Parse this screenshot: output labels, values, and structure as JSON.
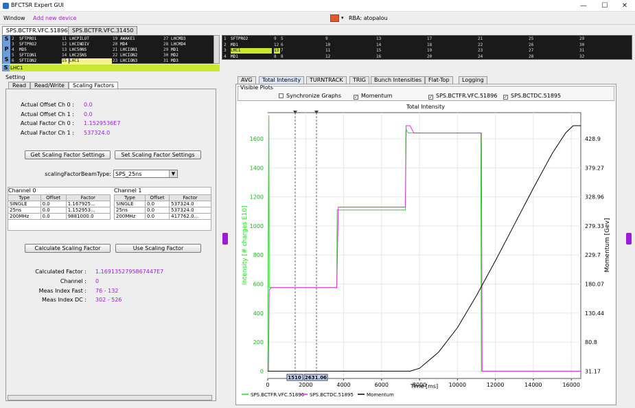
{
  "window": {
    "title": "BFCTSR Expert GUI",
    "minimize": "—",
    "maximize": "☐",
    "close": "✕"
  },
  "menu": {
    "window": "Window",
    "add_device": "Add new device"
  },
  "rba": {
    "label": "RBA: atopalou",
    "arrow": "▾"
  },
  "device_tabs": [
    "SPS.BCTFR.VFC.51896",
    "SPS.BCTFR.VFC.31450"
  ],
  "selector_left": {
    "side_labels": [
      "S",
      "P",
      "S"
    ],
    "rows": [
      [
        "2",
        "SFTPRO1",
        "11",
        "LHCPILOT",
        "19",
        "AWAKE1",
        "27",
        "LHCMD3"
      ],
      [
        "3",
        "SFTPRO2",
        "12",
        "LHCINDIV",
        "20",
        "MD4",
        "28",
        "LHCMD4"
      ],
      [
        "4",
        "MD5",
        "13",
        "LHC50NS",
        "21",
        "LHCION1",
        "29",
        "MD1"
      ],
      [
        "5",
        "SFTION1",
        "14",
        "LHC25NS",
        "22",
        "LHCION2",
        "30",
        "MD2"
      ],
      [
        "6",
        "SFTION2",
        "15",
        "LHC1",
        "23",
        "LHCION3",
        "31",
        "MD3"
      ]
    ],
    "selected": "LHC1"
  },
  "selector_right": {
    "rows": [
      [
        "1",
        "SFTPRO2",
        "9",
        "5",
        "9",
        "13",
        "17",
        "21",
        "25",
        "29"
      ],
      [
        "2",
        "MD1",
        "12",
        "6",
        "10",
        "14",
        "18",
        "22",
        "26",
        "30"
      ],
      [
        "3",
        "LHC1",
        "13",
        "7",
        "11",
        "15",
        "19",
        "23",
        "27",
        "31"
      ],
      [
        "4",
        "MD1",
        "8",
        "8",
        "12",
        "16",
        "20",
        "24",
        "28",
        "32"
      ]
    ]
  },
  "setting": {
    "group_label": "Setting",
    "tabs": [
      "Read",
      "Read/Write",
      "Scaling Factors"
    ],
    "actual": [
      {
        "label": "Actual Offset Ch 0 :",
        "value": "0.0"
      },
      {
        "label": "Actual Offset Ch 1 :",
        "value": "0.0"
      },
      {
        "label": "Actual Factor Ch 0 :",
        "value": "1.1529536E7"
      },
      {
        "label": "Actual Factor Ch 1 :",
        "value": "537324.0"
      }
    ],
    "get_button": "Get Scaling Factor Settings",
    "set_button": "Set Scaling Factor Settings",
    "beam_type_label": "scalingFactorBeamType:",
    "beam_type_value": "SPS_25ns",
    "channel0": {
      "title": "Channel 0",
      "headers": [
        "Type",
        "Offset",
        "Factor"
      ],
      "rows": [
        [
          "SINGLE",
          "0.0",
          "1.167925..."
        ],
        [
          "25ns",
          "0.0",
          "1.152953..."
        ],
        [
          "200MHz",
          "0.0",
          "9881000.0"
        ]
      ]
    },
    "channel1": {
      "title": "Channel 1",
      "headers": [
        "Type",
        "Offset",
        "Factor"
      ],
      "rows": [
        [
          "SINGLE",
          "0.0",
          "537324.0"
        ],
        [
          "25ns",
          "0.0",
          "537324.0"
        ],
        [
          "200MHz",
          "0.0",
          "417762.0..."
        ]
      ]
    },
    "calc_button": "Calculate Scaling Factor",
    "use_button": "Use Scaling Factor",
    "calculated": [
      {
        "label": "Calculated Factor :",
        "value": "1.1691352795867447E7"
      },
      {
        "label": "Channel :",
        "value": "0"
      },
      {
        "label": "Meas Index Fast :",
        "value": "76 - 132"
      },
      {
        "label": "Meas Index DC :",
        "value": "302 - 526"
      }
    ]
  },
  "chart_tabs": [
    "AVG",
    "Total Intensity",
    "TURNTRACK",
    "TRIG",
    "Bunch Intensities",
    "Flat-Top",
    "Logging"
  ],
  "visible_plots": {
    "label": "Visible Plots",
    "items": [
      {
        "label": "Synchronize Graphs",
        "checked": false
      },
      {
        "label": "Momentum",
        "checked": true
      },
      {
        "label": "SPS.BCTFR.VFC.51896",
        "checked": true
      },
      {
        "label": "SPS.BCTDC.51895",
        "checked": true
      }
    ]
  },
  "marker_labels": [
    "1510",
    "2631.06"
  ],
  "colors": {
    "green": "#22dd22",
    "magenta": "#ee22ee",
    "black": "#000000",
    "accent": "#9b1bd9",
    "selection": "#c8e830"
  },
  "chart_data": {
    "type": "line",
    "title": "Total Intensity",
    "xlabel": "Time [ms]",
    "ylabel": "Intensity [# charges E10]",
    "y2label": "Momentum [Gev]",
    "xlim": [
      0,
      16500
    ],
    "ylim": [
      -50,
      1780
    ],
    "x_ticks": [
      0,
      2000,
      4000,
      6000,
      8000,
      10000,
      12000,
      14000,
      16000
    ],
    "y_ticks": [
      0,
      200,
      400,
      600,
      800,
      1000,
      1200,
      1400,
      1600
    ],
    "y2_ticks": [
      "31.17",
      "80.8",
      "130.44",
      "180.07",
      "229.7",
      "279.33",
      "328.96",
      "379.27",
      "428.9"
    ],
    "series": [
      {
        "name": "SPS.BCTFR.VFC.51896",
        "color": "#22dd22",
        "x": [
          0,
          10,
          60,
          80,
          3640,
          3660,
          3700,
          7260,
          7280,
          7320,
          7400,
          11200,
          11230,
          11260,
          16500
        ],
        "y": [
          0,
          290,
          1760,
          575,
          575,
          1110,
          1110,
          1110,
          1660,
          1660,
          1640,
          1640,
          1640,
          0,
          0
        ]
      },
      {
        "name": "SPS.BCTDC.51895",
        "color": "#ee22ee",
        "x": [
          0,
          40,
          80,
          200,
          3640,
          3700,
          3720,
          7260,
          7300,
          7500,
          7700,
          11200,
          11260,
          11300,
          16500
        ],
        "y": [
          0,
          0,
          560,
          575,
          575,
          1000,
          1130,
          1130,
          1690,
          1690,
          1640,
          1640,
          1640,
          0,
          0
        ]
      },
      {
        "name": "Momentum",
        "color": "#000000",
        "x": [
          0,
          7500,
          8000,
          9000,
          10000,
          11000,
          12000,
          13000,
          14000,
          15000,
          15700,
          16100,
          16500
        ],
        "y": [
          0,
          0,
          20,
          130,
          300,
          520,
          760,
          1010,
          1260,
          1500,
          1640,
          1690,
          1690
        ]
      }
    ]
  }
}
